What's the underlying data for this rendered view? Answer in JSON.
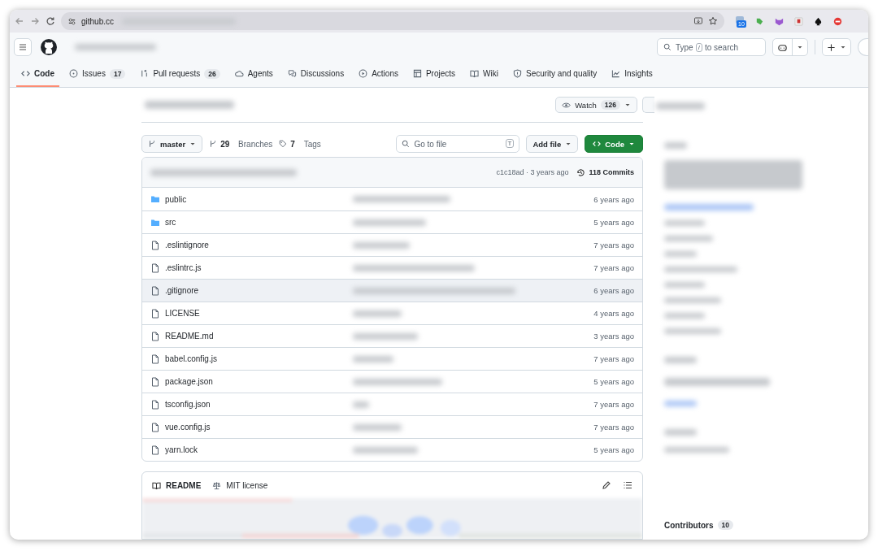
{
  "browser": {
    "url": "github.cc",
    "extensions": [
      {
        "kind": "badge-box",
        "badge": "10"
      },
      {
        "kind": "puzzle"
      },
      {
        "kind": "mask"
      },
      {
        "kind": "tile"
      },
      {
        "kind": "spade"
      },
      {
        "kind": "stop"
      }
    ]
  },
  "header": {
    "search": {
      "before": "Type",
      "key": "/",
      "after": "to search"
    }
  },
  "nav": [
    {
      "label": "Code",
      "kind": "code",
      "selected": true
    },
    {
      "label": "Issues",
      "kind": "issue",
      "count": "17",
      "selected": false
    },
    {
      "label": "Pull requests",
      "kind": "pr",
      "count": "26",
      "selected": false
    },
    {
      "label": "Agents",
      "kind": "cloud",
      "selected": false
    },
    {
      "label": "Discussions",
      "kind": "chat",
      "selected": false
    },
    {
      "label": "Actions",
      "kind": "play",
      "selected": false
    },
    {
      "label": "Projects",
      "kind": "table",
      "selected": false
    },
    {
      "label": "Wiki",
      "kind": "book",
      "selected": false
    },
    {
      "label": "Security and quality",
      "kind": "shield",
      "selected": false
    },
    {
      "label": "Insights",
      "kind": "graph",
      "selected": false
    }
  ],
  "repo": {
    "watch": {
      "label": "Watch",
      "count": "126"
    }
  },
  "toolbar": {
    "branch": "master",
    "branches_count": "29",
    "branches_label": "Branches",
    "tags_count": "7",
    "tags_label": "Tags",
    "go_to_file": {
      "placeholder": "Go to file",
      "key": "T"
    },
    "add_file": "Add file",
    "code": "Code"
  },
  "commit": {
    "meta": "c1c18ad · 3 years ago",
    "commits": "118 Commits"
  },
  "files": [
    {
      "name": "public",
      "kind": "folder",
      "time": "6 years ago",
      "highlighted": false
    },
    {
      "name": "src",
      "kind": "folder",
      "time": "5 years ago",
      "highlighted": false
    },
    {
      "name": ".eslintignore",
      "kind": "file",
      "time": "7 years ago",
      "highlighted": false
    },
    {
      "name": ".eslintrc.js",
      "kind": "file",
      "time": "7 years ago",
      "highlighted": false
    },
    {
      "name": ".gitignore",
      "kind": "file",
      "time": "6 years ago",
      "highlighted": true
    },
    {
      "name": "LICENSE",
      "kind": "file",
      "time": "4 years ago",
      "highlighted": false
    },
    {
      "name": "README.md",
      "kind": "file",
      "time": "3 years ago",
      "highlighted": false
    },
    {
      "name": "babel.config.js",
      "kind": "file",
      "time": "7 years ago",
      "highlighted": false
    },
    {
      "name": "package.json",
      "kind": "file",
      "time": "5 years ago",
      "highlighted": false
    },
    {
      "name": "tsconfig.json",
      "kind": "file",
      "time": "7 years ago",
      "highlighted": false
    },
    {
      "name": "vue.config.js",
      "kind": "file",
      "time": "7 years ago",
      "highlighted": false
    },
    {
      "name": "yarn.lock",
      "kind": "file",
      "time": "5 years ago",
      "highlighted": false
    }
  ],
  "readme": {
    "tabs": [
      {
        "label": "README",
        "kind": "book",
        "selected": true
      },
      {
        "label": "MIT license",
        "kind": "scale",
        "selected": false
      }
    ]
  },
  "sidebar": {
    "contributors": {
      "label": "Contributors",
      "count": "10"
    }
  }
}
